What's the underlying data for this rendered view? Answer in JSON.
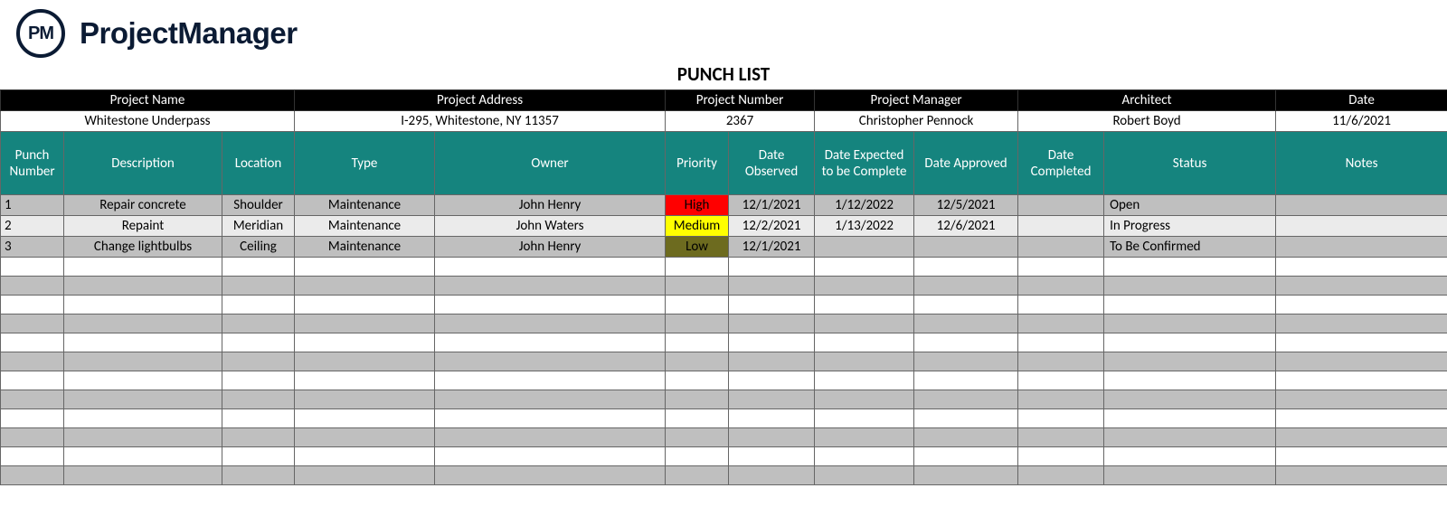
{
  "brand": {
    "logoText": "PM",
    "name": "ProjectManager"
  },
  "title": "PUNCH LIST",
  "meta": {
    "labels": {
      "projectName": "Project Name",
      "projectAddress": "Project Address",
      "projectNumber": "Project Number",
      "projectManager": "Project Manager",
      "architect": "Architect",
      "date": "Date"
    },
    "values": {
      "projectName": "Whitestone Underpass",
      "projectAddress": "I-295, Whitestone, NY 11357",
      "projectNumber": "2367",
      "projectManager": "Christopher Pennock",
      "architect": "Robert Boyd",
      "date": "11/6/2021"
    }
  },
  "columns": {
    "punchNumber": "Punch Number",
    "description": "Description",
    "location": "Location",
    "type": "Type",
    "owner": "Owner",
    "priority": "Priority",
    "dateObserved": "Date Observed",
    "dateExpected": "Date Expected to be Complete",
    "dateApproved": "Date Approved",
    "dateCompleted": "Date Completed",
    "status": "Status",
    "notes": "Notes"
  },
  "rows": [
    {
      "num": "1",
      "description": "Repair concrete",
      "location": "Shoulder",
      "type": "Maintenance",
      "owner": "John Henry",
      "priority": "High",
      "priorityClass": "priority-high",
      "dateObserved": "12/1/2021",
      "dateExpected": "1/12/2022",
      "dateApproved": "12/5/2021",
      "dateCompleted": "",
      "status": "Open",
      "notes": ""
    },
    {
      "num": "2",
      "description": "Repaint",
      "location": "Meridian",
      "type": "Maintenance",
      "owner": "John Waters",
      "priority": "Medium",
      "priorityClass": "priority-medium",
      "dateObserved": "12/2/2021",
      "dateExpected": "1/13/2022",
      "dateApproved": "12/6/2021",
      "dateCompleted": "",
      "status": "In Progress",
      "notes": ""
    },
    {
      "num": "3",
      "description": "Change lightbulbs",
      "location": "Ceiling",
      "type": "Maintenance",
      "owner": "John Henry",
      "priority": "Low",
      "priorityClass": "priority-low",
      "dateObserved": "12/1/2021",
      "dateExpected": "",
      "dateApproved": "",
      "dateCompleted": "",
      "status": "To Be Confirmed",
      "notes": ""
    }
  ],
  "emptyRows": 12
}
